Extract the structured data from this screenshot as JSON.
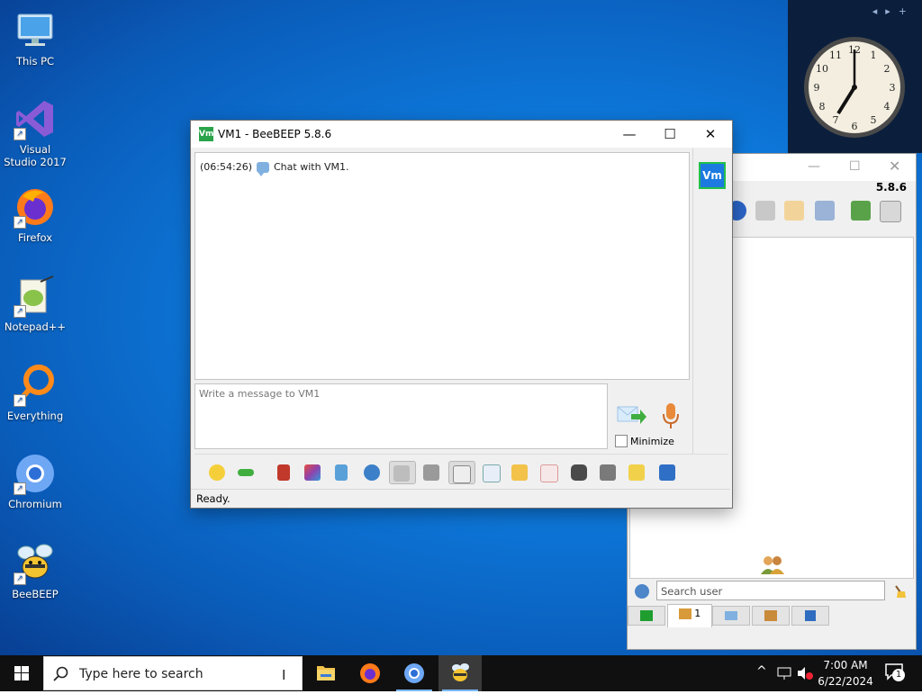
{
  "desktop": {
    "icons": [
      {
        "label": "This PC"
      },
      {
        "label": "Visual Studio 2017"
      },
      {
        "label": "Firefox"
      },
      {
        "label": "Notepad++"
      },
      {
        "label": "Everything"
      },
      {
        "label": "Chromium"
      },
      {
        "label": "BeeBEEP"
      }
    ]
  },
  "gadget": {
    "nav_prev": "◂",
    "nav_next": "▸",
    "add": "+"
  },
  "main_window": {
    "version": "5.8.6",
    "search_placeholder": "Search user",
    "users_tab_count": "1"
  },
  "chat_window": {
    "icon_text": "Vm",
    "title": "VM1 - BeeBEEP 5.8.6",
    "minimize_glyph": "—",
    "maximize_glyph": "☐",
    "close_glyph": "✕",
    "history": [
      {
        "time": "(06:54:26)",
        "text": "Chat with VM1."
      }
    ],
    "avatar_text": "Vm",
    "input_placeholder": "Write a message to VM1",
    "minimize_label": "Minimize",
    "status": "Ready."
  },
  "toolbar": {
    "items": [
      "emoticons-icon",
      "dropdown-icon",
      "font-icon",
      "color-icon",
      "filter-icon",
      "settings-icon",
      "spellcheck-icon",
      "word-complete-icon",
      "use-return-icon",
      "send-file-icon",
      "send-folder-icon",
      "html-icon",
      "screenshot-icon",
      "voice-icon",
      "quick-save-icon",
      "save-icon"
    ]
  },
  "taskbar": {
    "search_placeholder": "Type here to search",
    "time": "7:00 AM",
    "date": "6/22/2024",
    "notification_count": "1"
  },
  "colors": {
    "accent": "#0a78d7",
    "taskbar": "#101010",
    "vm_avatar": "#1c7ae0",
    "vm_avatar_border": "#22c04a"
  }
}
